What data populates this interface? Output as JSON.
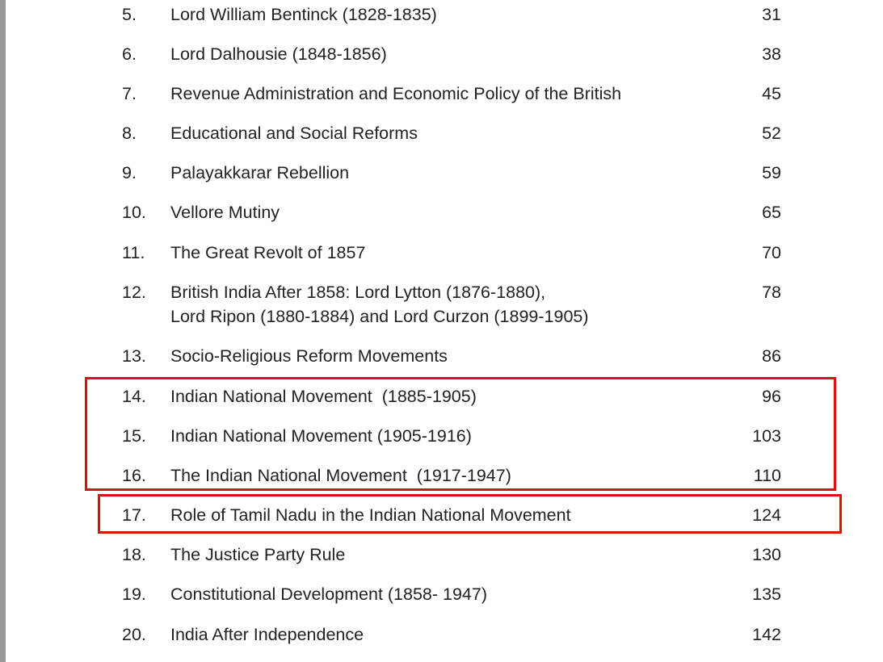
{
  "toc": {
    "entries": [
      {
        "num": "5.",
        "title": "Lord William Bentinck (1828-1835)",
        "page": "31"
      },
      {
        "num": "6.",
        "title": "Lord Dalhousie (1848-1856)",
        "page": "38"
      },
      {
        "num": "7.",
        "title": "Revenue Administration and Economic Policy of the British",
        "page": "45"
      },
      {
        "num": "8.",
        "title": "Educational and Social Reforms",
        "page": "52"
      },
      {
        "num": "9.",
        "title": "Palayakkarar Rebellion",
        "page": "59"
      },
      {
        "num": "10.",
        "title": "Vellore Mutiny",
        "page": "65"
      },
      {
        "num": "11.",
        "title": "The Great Revolt of 1857",
        "page": "70"
      },
      {
        "num": "12.",
        "title": "British India After 1858: Lord Lytton (1876-1880),",
        "title_line2": "Lord Ripon (1880-1884) and Lord Curzon (1899-1905)",
        "page": "78"
      },
      {
        "num": "13.",
        "title": "Socio-Religious Reform Movements",
        "page": "86"
      },
      {
        "num": "14.",
        "title": "Indian National Movement  (1885-1905)",
        "page": "96"
      },
      {
        "num": "15.",
        "title": "Indian National Movement (1905-1916)",
        "page": "103"
      },
      {
        "num": "16.",
        "title": "The Indian National Movement  (1917-1947)",
        "page": "110"
      },
      {
        "num": "17.",
        "title": "Role of Tamil Nadu in the Indian National Movement",
        "page": "124"
      },
      {
        "num": "18.",
        "title": "The Justice Party Rule",
        "page": "130"
      },
      {
        "num": "19.",
        "title": "Constitutional Development (1858- 1947)",
        "page": "135"
      },
      {
        "num": "20.",
        "title": "India After Independence",
        "page": "142"
      }
    ]
  },
  "annotations": {
    "highlight_color": "#dd1111"
  }
}
